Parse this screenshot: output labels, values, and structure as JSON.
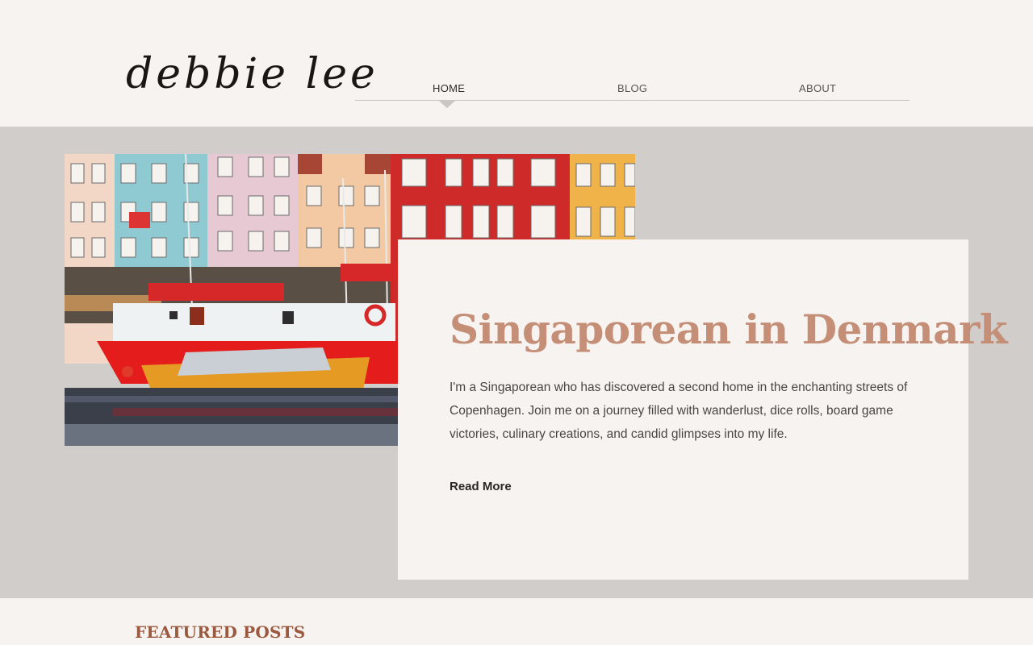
{
  "site": {
    "logo": "debbie lee"
  },
  "nav": {
    "items": [
      {
        "label": "HOME",
        "active": true
      },
      {
        "label": "BLOG",
        "active": false
      },
      {
        "label": "ABOUT",
        "active": false
      }
    ]
  },
  "hero": {
    "image_subject": "Colorful harbour houses with red boat and yellow rowboat",
    "title": "Singaporean in Denmark",
    "body": "I'm a Singaporean who has discovered a second home in the enchanting streets of Copenhagen. Join me on a journey filled with wanderlust, dice rolls, board game victories, culinary creations, and candid glimpses into my life.",
    "cta": "Read More"
  },
  "featured": {
    "heading": "FEATURED POSTS"
  },
  "colors": {
    "background": "#f6f3f0",
    "hero_band": "#d1cdca",
    "title_accent": "#c48e77",
    "featured_heading": "#9b5a3f"
  }
}
